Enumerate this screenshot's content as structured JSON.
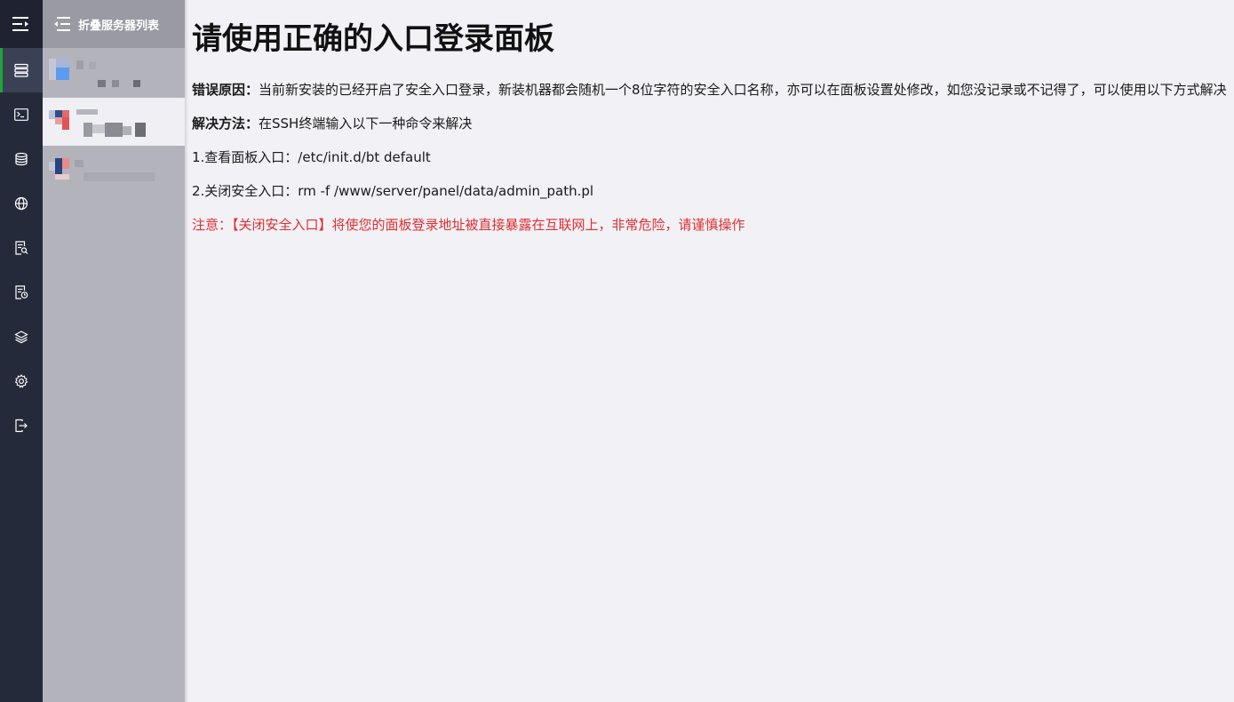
{
  "app": {
    "collapse_label": "折叠服务器列表"
  },
  "rail": {
    "items": [
      {
        "icon": "menu-toggle-icon"
      },
      {
        "icon": "server-list-icon",
        "active": true
      },
      {
        "icon": "terminal-icon"
      },
      {
        "icon": "database-icon"
      },
      {
        "icon": "globe-icon"
      },
      {
        "icon": "search-file-icon"
      },
      {
        "icon": "scheduled-task-icon"
      },
      {
        "icon": "layers-icon"
      },
      {
        "icon": "settings-icon"
      },
      {
        "icon": "logout-icon"
      }
    ]
  },
  "servers": [
    {
      "state": "normal"
    },
    {
      "state": "selected"
    },
    {
      "state": "normal"
    }
  ],
  "page": {
    "title": "请使用正确的入口登录面板",
    "reason_label": "错误原因：",
    "reason_text": "当前新安装的已经开启了安全入口登录，新装机器都会随机一个8位字符的安全入口名称，亦可以在面板设置处修改，如您没记录或不记得了，可以使用以下方式解决",
    "method_label": "解决方法：",
    "method_text": "在SSH终端输入以下一种命令来解决",
    "step1": "1.查看面板入口：/etc/init.d/bt default",
    "step2": "2.关闭安全入口：rm -f /www/server/panel/data/admin_path.pl",
    "warning": "注意：【关闭安全入口】将使您的面板登录地址被直接暴露在互联网上，非常危险，请谨慎操作"
  },
  "colors": {
    "rail_bg": "#252a3a",
    "accent": "#20a53a",
    "warning": "#e03030"
  }
}
